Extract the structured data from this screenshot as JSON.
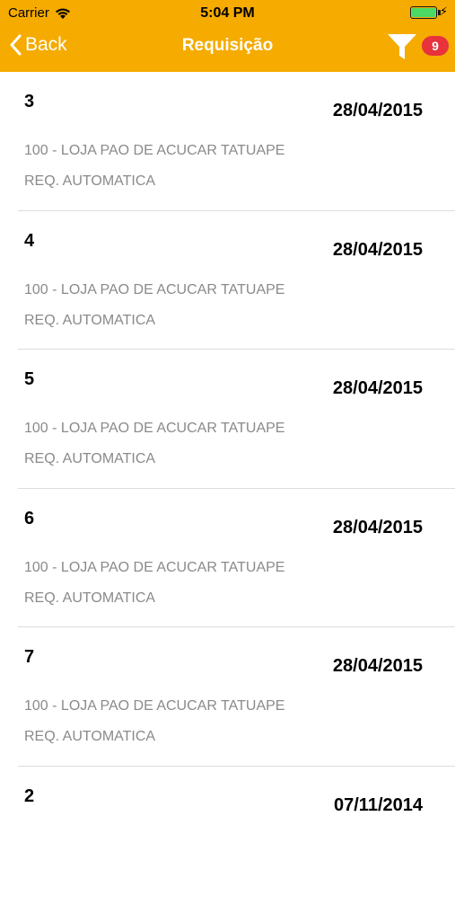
{
  "status_bar": {
    "carrier": "Carrier",
    "time": "5:04 PM"
  },
  "nav": {
    "back_label": "Back",
    "title": "Requisição",
    "filter_count": "9"
  },
  "colors": {
    "accent": "#f5ab00",
    "badge": "#e8323c",
    "secondary_text": "#8a8a8a"
  },
  "rows": [
    {
      "number": "3",
      "date": "28/04/2015",
      "store": "100 - LOJA PAO DE ACUCAR TATUAPE",
      "type": "REQ. AUTOMATICA"
    },
    {
      "number": "4",
      "date": "28/04/2015",
      "store": "100 - LOJA PAO DE ACUCAR TATUAPE",
      "type": "REQ. AUTOMATICA"
    },
    {
      "number": "5",
      "date": "28/04/2015",
      "store": "100 - LOJA PAO DE ACUCAR TATUAPE",
      "type": "REQ. AUTOMATICA"
    },
    {
      "number": "6",
      "date": "28/04/2015",
      "store": "100 - LOJA PAO DE ACUCAR TATUAPE",
      "type": "REQ. AUTOMATICA"
    },
    {
      "number": "7",
      "date": "28/04/2015",
      "store": "100 - LOJA PAO DE ACUCAR TATUAPE",
      "type": "REQ. AUTOMATICA"
    },
    {
      "number": "2",
      "date": "07/11/2014",
      "store": "",
      "type": ""
    }
  ]
}
